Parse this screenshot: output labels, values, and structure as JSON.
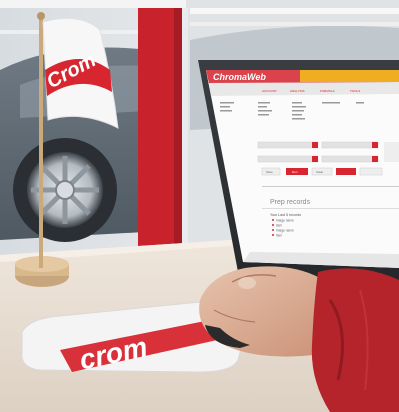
{
  "photo": {
    "flag_logo": "Crom",
    "mousepad_logo": "crom"
  },
  "laptop_screen": {
    "app_logo": "ChromaWeb",
    "nav_items": [
      "ACCOUNT",
      "ANALYSIS",
      "FORMULA",
      "TOOLS"
    ],
    "section_heading": "Prep records",
    "recent_label": "Your Last 5 records",
    "recent_items": [
      "Image name",
      "Item",
      "Image name",
      "Item"
    ],
    "button_labels": [
      "Save",
      "Run",
      "Clear"
    ]
  },
  "colors": {
    "brand_red": "#d7262f",
    "pillar_red": "#c8232c",
    "desk": "#e9dfd4",
    "sleeve_red": "#b5242a"
  }
}
